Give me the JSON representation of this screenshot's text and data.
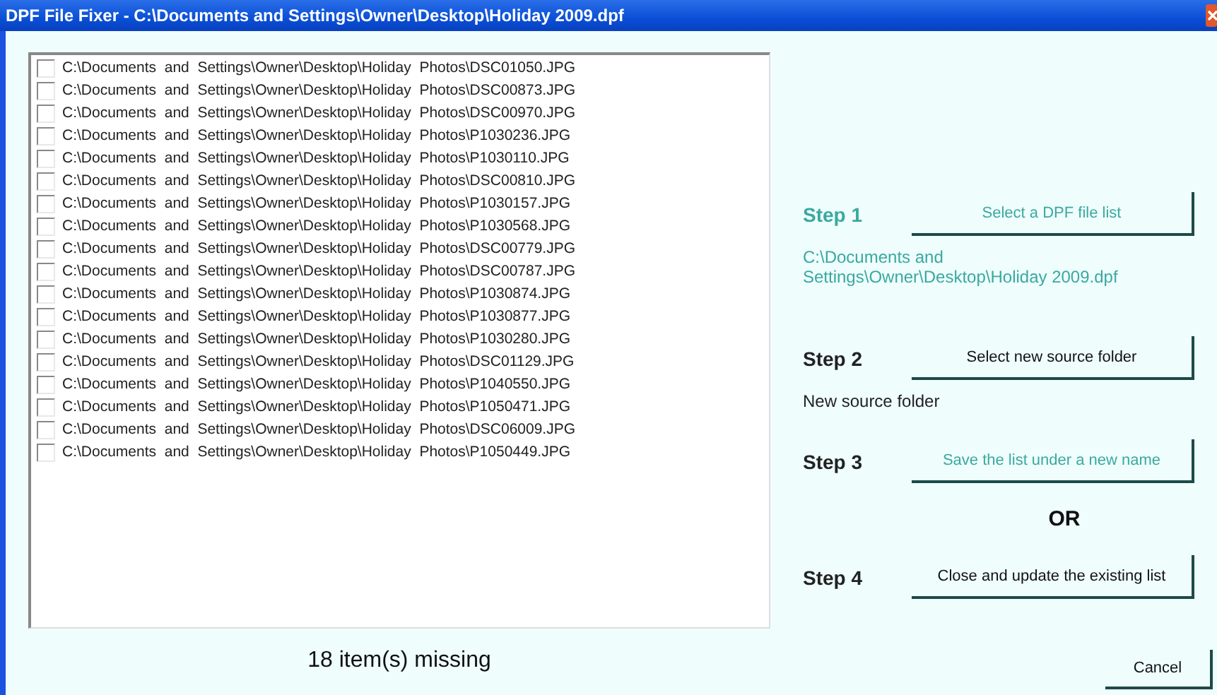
{
  "window": {
    "title": "DPF File Fixer - C:\\Documents and Settings\\Owner\\Desktop\\Holiday 2009.dpf"
  },
  "file_list": [
    {
      "path": "C:\\Documents  and  Settings\\Owner\\Desktop\\Holiday  Photos\\DSC01050.JPG",
      "checked": false
    },
    {
      "path": "C:\\Documents  and  Settings\\Owner\\Desktop\\Holiday  Photos\\DSC00873.JPG",
      "checked": false
    },
    {
      "path": "C:\\Documents  and  Settings\\Owner\\Desktop\\Holiday  Photos\\DSC00970.JPG",
      "checked": false
    },
    {
      "path": "C:\\Documents  and  Settings\\Owner\\Desktop\\Holiday  Photos\\P1030236.JPG",
      "checked": false
    },
    {
      "path": "C:\\Documents  and  Settings\\Owner\\Desktop\\Holiday  Photos\\P1030110.JPG",
      "checked": false
    },
    {
      "path": "C:\\Documents  and  Settings\\Owner\\Desktop\\Holiday  Photos\\DSC00810.JPG",
      "checked": false
    },
    {
      "path": "C:\\Documents  and  Settings\\Owner\\Desktop\\Holiday  Photos\\P1030157.JPG",
      "checked": false
    },
    {
      "path": "C:\\Documents  and  Settings\\Owner\\Desktop\\Holiday  Photos\\P1030568.JPG",
      "checked": false
    },
    {
      "path": "C:\\Documents  and  Settings\\Owner\\Desktop\\Holiday  Photos\\DSC00779.JPG",
      "checked": false
    },
    {
      "path": "C:\\Documents  and  Settings\\Owner\\Desktop\\Holiday  Photos\\DSC00787.JPG",
      "checked": false
    },
    {
      "path": "C:\\Documents  and  Settings\\Owner\\Desktop\\Holiday  Photos\\P1030874.JPG",
      "checked": false
    },
    {
      "path": "C:\\Documents  and  Settings\\Owner\\Desktop\\Holiday  Photos\\P1030877.JPG",
      "checked": false
    },
    {
      "path": "C:\\Documents  and  Settings\\Owner\\Desktop\\Holiday  Photos\\P1030280.JPG",
      "checked": false
    },
    {
      "path": "C:\\Documents  and  Settings\\Owner\\Desktop\\Holiday  Photos\\DSC01129.JPG",
      "checked": false
    },
    {
      "path": "C:\\Documents  and  Settings\\Owner\\Desktop\\Holiday  Photos\\P1040550.JPG",
      "checked": false
    },
    {
      "path": "C:\\Documents  and  Settings\\Owner\\Desktop\\Holiday  Photos\\P1050471.JPG",
      "checked": false
    },
    {
      "path": "C:\\Documents  and  Settings\\Owner\\Desktop\\Holiday  Photos\\DSC06009.JPG",
      "checked": false
    },
    {
      "path": "C:\\Documents  and  Settings\\Owner\\Desktop\\Holiday  Photos\\P1050449.JPG",
      "checked": false
    }
  ],
  "status": "18 item(s) missing",
  "steps": [
    {
      "kind": "step",
      "label": "Step 1",
      "active": true,
      "button": {
        "label": "Select a DPF file list",
        "highlighted": true
      },
      "info": "C:\\Documents and Settings\\Owner\\Desktop\\Holiday 2009.dpf"
    },
    {
      "kind": "step",
      "label": "Step 2",
      "active": false,
      "button": {
        "label": "Select new source folder",
        "highlighted": false
      },
      "info": "New source folder"
    },
    {
      "kind": "step",
      "label": "Step 3",
      "active": false,
      "button": {
        "label": "Save the list under a new name",
        "highlighted": true
      }
    },
    {
      "kind": "separator",
      "label": "OR"
    },
    {
      "kind": "step",
      "label": "Step 4",
      "active": false,
      "button": {
        "label": "Close and update the existing list",
        "highlighted": false
      }
    }
  ],
  "cancel_button": "Cancel"
}
